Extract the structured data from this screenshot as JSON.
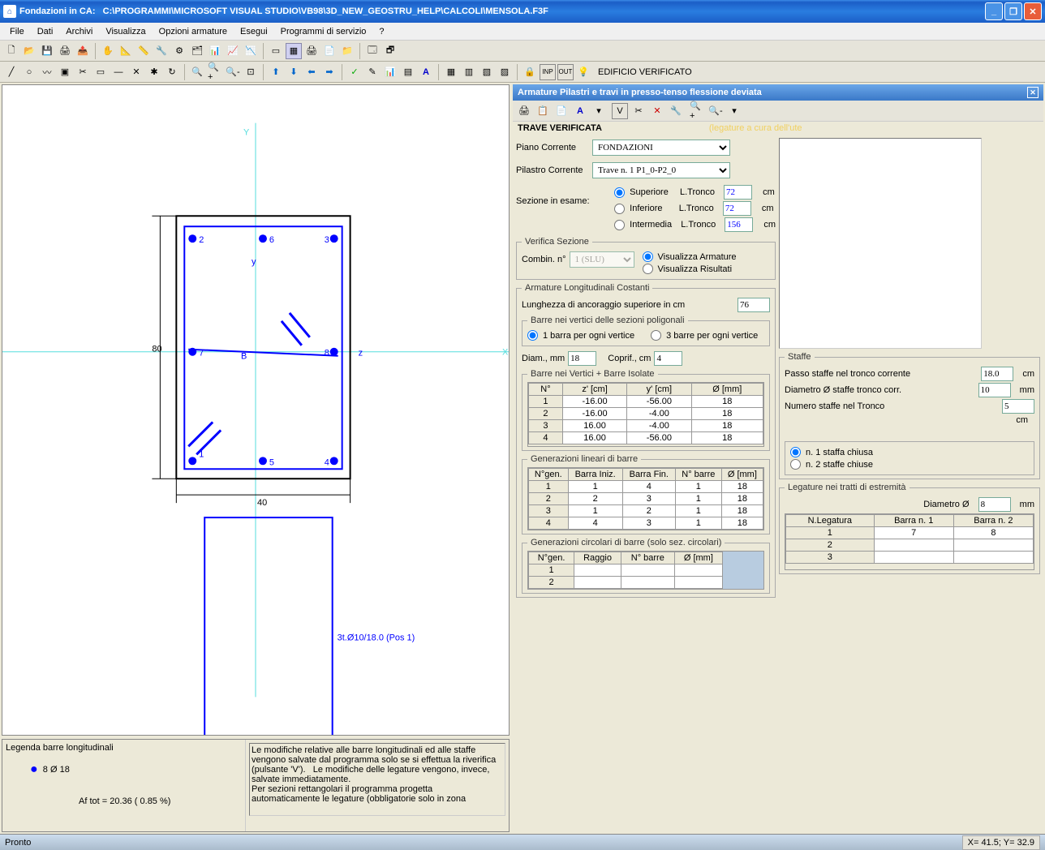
{
  "window": {
    "app": "Fondazioni in CA:",
    "path": "C:\\PROGRAMMI\\MICROSOFT VISUAL STUDIO\\VB98\\3D_NEW_GEOSTRU_HELP\\CALCOLI\\MENSOLA.F3F"
  },
  "menu": [
    "File",
    "Dati",
    "Archivi",
    "Visualizza",
    "Opzioni armature",
    "Esegui",
    "Programmi di servizio",
    "?"
  ],
  "toolbar2_status": "EDIFICIO VERIFICATO",
  "canvas": {
    "y_label": "Y",
    "x_label": "X",
    "z_label": "z",
    "y2_label": "y",
    "b_label": "B",
    "dim_h": "80",
    "dim_w": "40",
    "pts": [
      "1",
      "2",
      "3",
      "4",
      "5",
      "6",
      "7",
      "8"
    ],
    "annot": "3t.Ø10/18.0 (Pos 1)"
  },
  "legend": {
    "title": "Legenda barre longitudinali",
    "entry": "8 Ø 18",
    "af": "Af tot = 20.36   ( 0.85 %)"
  },
  "notes": "Le modifiche relative alle barre longitudinali ed alle staffe vengono salvate dal programma solo se si effettua la riverifica (pulsante 'V').   Le modifiche delle legature vengono, invece, salvate immediatamente.\nPer sezioni rettangolari il programma progetta automaticamente le legature (obbligatorie solo in zona",
  "panel": {
    "title": "Armature  Pilastri  e travi in presso-tenso flessione deviata",
    "travestatus": "TRAVE VERIFICATA",
    "utilnote": "(legature a cura dell'ute",
    "piano_lbl": "Piano Corrente",
    "piano_val": "FONDAZIONI",
    "pilastro_lbl": "Pilastro Corrente",
    "pilastro_val": "Trave n. 1   P1_0-P2_0",
    "sezione_lbl": "Sezione in esame:",
    "sup": "Superiore",
    "inf": "Inferiore",
    "int": "Intermedia",
    "ltronco": "L.Tronco",
    "ltronco_sup": "72",
    "ltronco_inf": "72",
    "ltronco_int": "156",
    "cm": "cm",
    "verifica_title": "Verifica Sezione",
    "combin_lbl": "Combin. n°",
    "combin_val": "1  (SLU)",
    "vis_arm": "Visualizza Armature",
    "vis_ris": "Visualizza Risultati",
    "arm_long_title": "Armature Longitudinali Costanti",
    "lung_anc_lbl": "Lunghezza di ancoraggio superiore in cm",
    "lung_anc_val": "76",
    "barre_vert_title": "Barre nei vertici delle sezioni poligonali",
    "b1": "1 barra per ogni vertice",
    "b3": "3 barre per ogni vertice",
    "diam_lbl": "Diam., mm",
    "diam_val": "18",
    "coprif_lbl": "Coprif., cm",
    "coprif_val": "4",
    "tbl1_title": "Barre nei Vertici + Barre Isolate",
    "tbl1_hdr": [
      "N°",
      "z'  [cm]",
      "y'  [cm]",
      "Ø  [mm]"
    ],
    "tbl1": [
      [
        "1",
        "-16.00",
        "-56.00",
        "18"
      ],
      [
        "2",
        "-16.00",
        "-4.00",
        "18"
      ],
      [
        "3",
        "16.00",
        "-4.00",
        "18"
      ],
      [
        "4",
        "16.00",
        "-56.00",
        "18"
      ]
    ],
    "tbl2_title": "Generazioni lineari di barre",
    "tbl2_hdr": [
      "N°gen.",
      "Barra Iniz.",
      "Barra Fin.",
      "N° barre",
      "Ø  [mm]"
    ],
    "tbl2": [
      [
        "1",
        "1",
        "4",
        "1",
        "18"
      ],
      [
        "2",
        "2",
        "3",
        "1",
        "18"
      ],
      [
        "3",
        "1",
        "2",
        "1",
        "18"
      ],
      [
        "4",
        "4",
        "3",
        "1",
        "18"
      ]
    ],
    "tbl3_title": "Generazioni circolari di barre (solo sez. circolari)",
    "tbl3_hdr": [
      "N°gen.",
      "Raggio",
      "N° barre",
      "Ø  [mm]"
    ],
    "tbl3_rows": [
      "1",
      "2"
    ],
    "staffe_title": "Staffe",
    "passo_lbl": "Passo staffe nel tronco corrente",
    "passo_val": "18.0",
    "diam_staffe_lbl": "Diametro Ø staffe tronco corr.",
    "diam_staffe_val": "10",
    "mm": "mm",
    "num_staffe_lbl": "Numero staffe nel Tronco",
    "num_staffe_val": "5",
    "s1": "n. 1 staffa chiusa",
    "s2": "n. 2 staffe chiuse",
    "leg_title": "Legature nei tratti di estremità",
    "leg_diam_lbl": "Diametro Ø",
    "leg_diam_val": "8",
    "leg_hdr": [
      "N.Legatura",
      "Barra n. 1",
      "Barra n. 2"
    ],
    "leg_rows": [
      [
        "1",
        "7",
        "8"
      ],
      [
        "2",
        "",
        ""
      ],
      [
        "3",
        "",
        ""
      ]
    ]
  },
  "statusbar": {
    "left": "Pronto",
    "right": "X= 41.5; Y= 32.9"
  }
}
